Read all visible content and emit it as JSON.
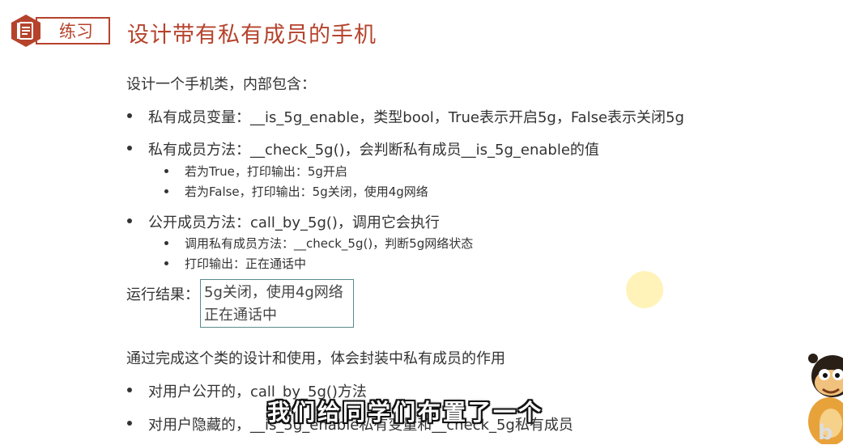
{
  "header": {
    "badge_label": "练习",
    "title": "设计带有私有成员的手机",
    "badge_color": "#b5432c"
  },
  "intro": "设计一个手机类，内部包含：",
  "bullets": [
    "私有成员变量：__is_5g_enable，类型bool，True表示开启5g，False表示关闭5g",
    "私有成员方法：__check_5g()，会判断私有成员__is_5g_enable的值",
    "公开成员方法：call_by_5g()，调用它会执行"
  ],
  "sub_bullets_a": [
    "若为True，打印输出：5g开启",
    "若为False，打印输出：5g关闭，使用4g网络"
  ],
  "sub_bullets_b": [
    "调用私有成员方法：__check_5g()，判断5g网络状态",
    "打印输出：正在通话中"
  ],
  "result": {
    "label": "运行结果：",
    "line1": "5g关闭，使用4g网络",
    "line2": "正在通话中"
  },
  "summary": "通过完成这个类的设计和使用，体会封装中私有成员的作用",
  "summary_bullets": [
    "对用户公开的，call_by_5g()方法",
    "对用户隐藏的，__is_5g_enable私有变量和__check_5g私有成员"
  ],
  "subtitle": "我们给同学们布置了一个",
  "icons": {
    "badge": "document-icon",
    "mascot": "monkey-mascot-icon"
  }
}
